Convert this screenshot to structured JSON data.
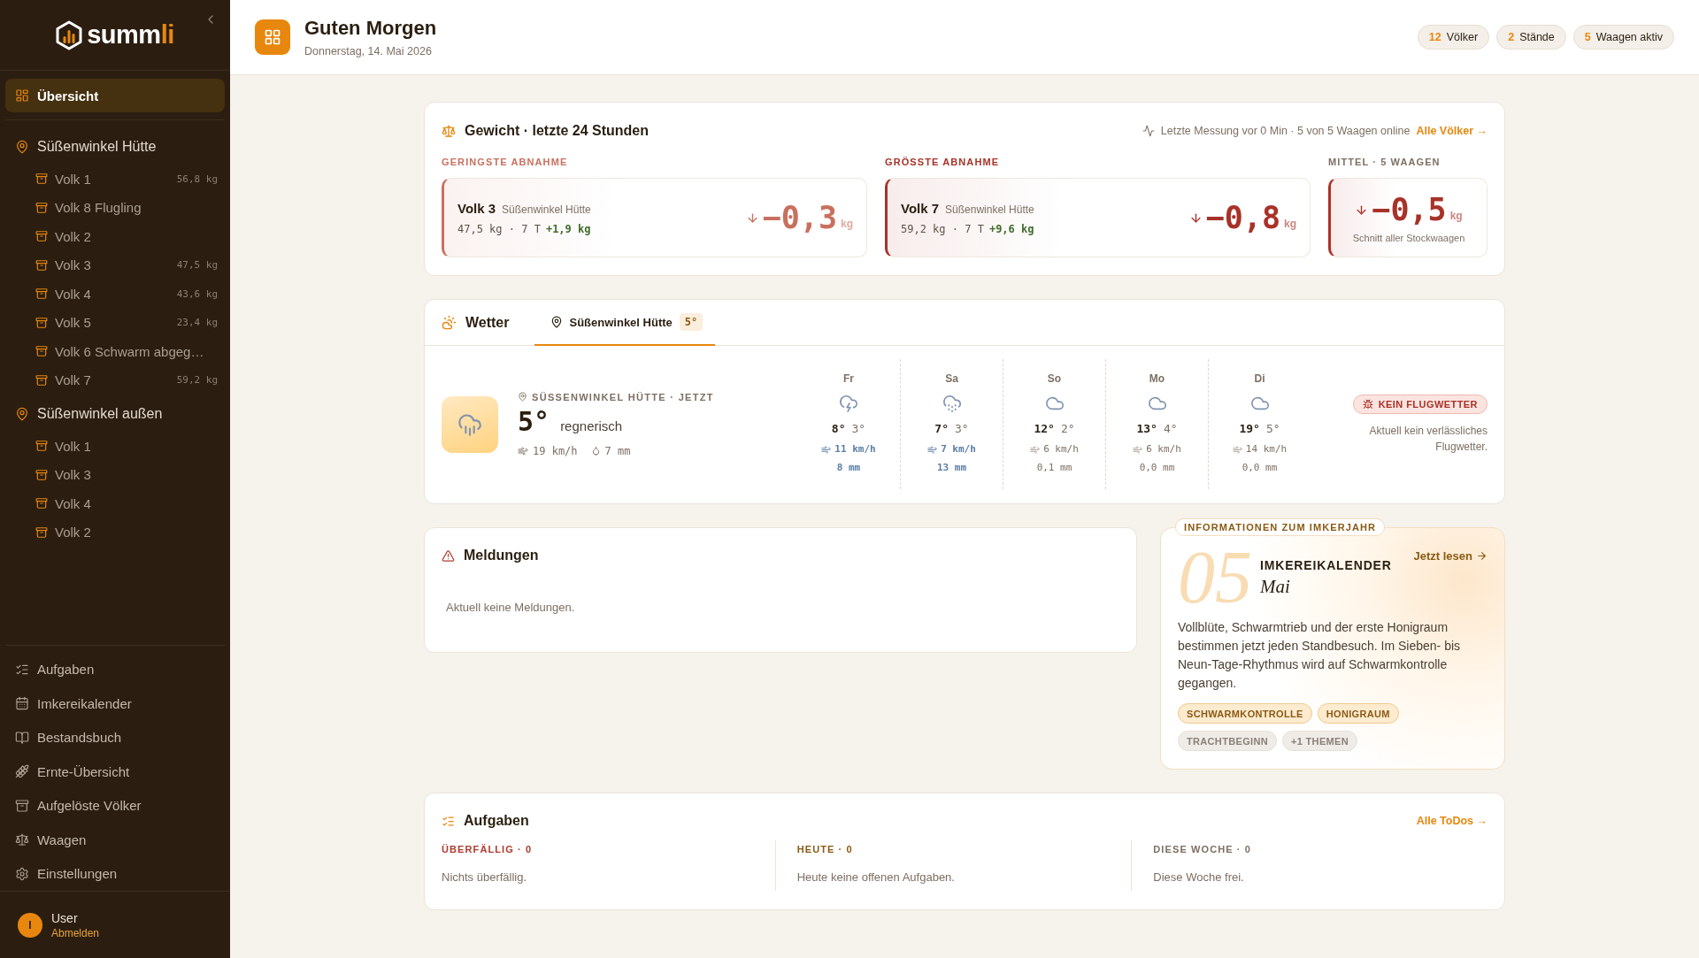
{
  "sidebar": {
    "logo": {
      "wordmark": "summ",
      "wordmark_accent": "li"
    },
    "main_items": [
      {
        "label": "Übersicht",
        "kind": "overview",
        "selected": true
      }
    ],
    "apiaries": [
      {
        "label": "Süßenwinkel Hütte",
        "children": [
          {
            "label": "Volk 1",
            "weight": "56,8 kg",
            "selected": false
          },
          {
            "label": "Volk 8 Flugling",
            "selected": false
          },
          {
            "label": "Volk 2",
            "selected": false
          },
          {
            "label": "Volk 3",
            "weight": "47,5 kg",
            "selected": false
          },
          {
            "label": "Volk 4",
            "weight": "43,6 kg",
            "selected": false
          },
          {
            "label": "Volk 5",
            "weight": "23,4 kg",
            "selected": false
          },
          {
            "label": "Volk 6 Schwarm abgeg…",
            "selected": false
          },
          {
            "label": "Volk 7",
            "weight": "59,2 kg",
            "selected": false
          }
        ]
      },
      {
        "label": "Süßenwinkel außen",
        "children": [
          {
            "label": "Volk 1",
            "selected": false
          },
          {
            "label": "Volk 3",
            "selected": false
          },
          {
            "label": "Volk 4",
            "selected": false
          },
          {
            "label": "Volk 2",
            "selected": false
          }
        ]
      }
    ],
    "bottom_items": [
      {
        "label": "Aufgaben",
        "kind": "tasks",
        "selected": false
      },
      {
        "label": "Imkereikalender",
        "kind": "calendar",
        "selected": false
      },
      {
        "label": "Bestandsbuch",
        "kind": "book",
        "selected": false
      },
      {
        "label": "Ernte-Übersicht",
        "kind": "harvest",
        "selected": false
      },
      {
        "label": "Aufgelöste Völker",
        "kind": "archive",
        "selected": false
      },
      {
        "label": "Waagen",
        "kind": "scale",
        "selected": false
      },
      {
        "label": "Einstellungen",
        "kind": "settings",
        "selected": false
      }
    ],
    "user": {
      "initial": "I",
      "name": "User",
      "logout": "Abmelden"
    }
  },
  "header": {
    "title": "Guten Morgen",
    "date": "Donnerstag, 14. Mai 2026",
    "stats": [
      {
        "count": "12",
        "label": "Völker"
      },
      {
        "count": "2",
        "label": "Stände"
      },
      {
        "count": "5",
        "label": "Waagen aktiv"
      }
    ]
  },
  "weight": {
    "title": "Gewicht · letzte 24 Stunden",
    "status": "Letzte Messung vor 0 Min · 5 von 5 Waagen online",
    "link": "Alle Völker →",
    "stats": [
      {
        "kind": "colony",
        "label": "GERINGSTE ABNAHME",
        "color": "#c8705f",
        "name": "Volk 3",
        "location": "Süßenwinkel Hütte",
        "detail": "47,5 kg · 7 T",
        "trend": "+1,9 kg",
        "value": "−0,3",
        "unit": "kg"
      },
      {
        "kind": "colony",
        "label": "GRÖSSTE ABNAHME",
        "color": "#a83228",
        "name": "Volk 7",
        "location": "Süßenwinkel Hütte",
        "detail": "59,2 kg · 7 T",
        "trend": "+9,6 kg",
        "value": "−0,8",
        "unit": "kg"
      },
      {
        "kind": "average",
        "label": "MITTEL · 5 WAAGEN",
        "color": "#a83228",
        "value": "−0,5",
        "unit": "kg",
        "caption": "Schnitt aller Stockwaagen"
      }
    ]
  },
  "weather": {
    "title": "Wetter",
    "tabs": [
      {
        "label": "Süßenwinkel Hütte",
        "badge": "5°",
        "selected": true
      }
    ],
    "current": {
      "label": "SÜSSENWINKEL HÜTTE · JETZT",
      "temperature": "5°",
      "condition": "regnerisch",
      "wind": "19 km/h",
      "rain": "7 mm"
    },
    "forecast": [
      {
        "day": "Fr",
        "kind": "storm",
        "high": "8°",
        "low": "3°",
        "wind": "11 km/h",
        "rain": "8 mm",
        "highlighted": true
      },
      {
        "day": "Sa",
        "kind": "rain",
        "high": "7°",
        "low": "3°",
        "wind": "7 km/h",
        "rain": "13 mm",
        "highlighted": true
      },
      {
        "day": "So",
        "kind": "cloud",
        "high": "12°",
        "low": "2°",
        "wind": "6 km/h",
        "rain": "0,1 mm",
        "highlighted": false
      },
      {
        "day": "Mo",
        "kind": "cloud",
        "high": "13°",
        "low": "4°",
        "wind": "6 km/h",
        "rain": "0,0 mm",
        "highlighted": false
      },
      {
        "day": "Di",
        "kind": "cloud",
        "high": "19°",
        "low": "5°",
        "wind": "14 km/h",
        "rain": "0,0 mm",
        "highlighted": false
      }
    ],
    "flight": {
      "badge": "KEIN FLUGWETTER",
      "note": "Aktuell kein verlässliches Flugwetter."
    }
  },
  "messages": {
    "title": "Meldungen",
    "empty": "Aktuell keine Meldungen."
  },
  "calendar": {
    "tag": "INFORMATIONEN ZUM IMKERJAHR",
    "month_number": "05",
    "title": "IMKEREIKALENDER",
    "month": "Mai",
    "link": "Jetzt lesen",
    "text": "Vollblüte, Schwarmtrieb und der erste Honigraum bestimmen jetzt jeden Standbesuch. Im Sieben- bis Neun-Tage-Rhythmus wird auf Schwarmkontrolle gegangen.",
    "topics": [
      {
        "label": "SCHWARMKONTROLLE",
        "highlighted": true
      },
      {
        "label": "HONIGRAUM",
        "highlighted": true
      },
      {
        "label": "TRACHTBEGINN",
        "highlighted": false
      },
      {
        "label": "+1 THEMEN",
        "highlighted": false
      }
    ]
  },
  "tasks": {
    "title": "Aufgaben",
    "link": "Alle ToDos →",
    "columns": [
      {
        "label": "ÜBERFÄLLIG · 0",
        "color": "#b03a2e",
        "empty": "Nichts überfällig."
      },
      {
        "label": "HEUTE · 0",
        "color": "#8a5a12",
        "empty": "Heute keine offenen Aufgaben."
      },
      {
        "label": "DIESE WOCHE · 0",
        "color": "#7d6f62",
        "empty": "Diese Woche frei."
      }
    ]
  }
}
